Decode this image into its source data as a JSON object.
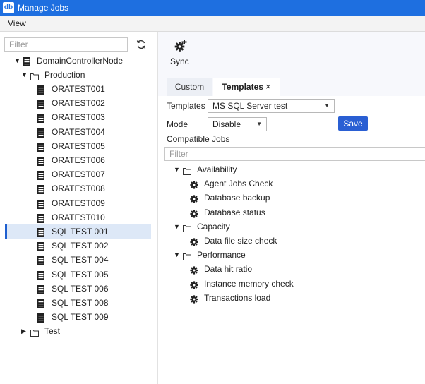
{
  "window": {
    "app_icon": "db",
    "title": "Manage Jobs"
  },
  "menu": {
    "view": "View"
  },
  "left": {
    "filter_placeholder": "Filter",
    "tree": {
      "root": "DomainControllerNode",
      "production": "Production",
      "servers": [
        "ORATEST001",
        "ORATEST002",
        "ORATEST003",
        "ORATEST004",
        "ORATEST005",
        "ORATEST006",
        "ORATEST007",
        "ORATEST008",
        "ORATEST009",
        "ORATEST010",
        "SQL TEST 001",
        "SQL TEST 002",
        "SQL TEST 004",
        "SQL TEST 005",
        "SQL TEST 006",
        "SQL TEST 008",
        "SQL TEST 009"
      ],
      "selected": "SQL TEST 001",
      "test": "Test"
    }
  },
  "toolbar": {
    "sync_label": "Sync"
  },
  "tabs": {
    "custom": "Custom",
    "templates": "Templates",
    "close": "×"
  },
  "form": {
    "templates_label": "Templates",
    "templates_value": "MS SQL Server test",
    "mode_label": "Mode",
    "mode_value": "Disable",
    "save_label": "Save",
    "compatible_jobs_label": "Compatible Jobs",
    "filter_placeholder": "Filter"
  },
  "jobs": {
    "groups": [
      {
        "name": "Availability",
        "items": [
          "Agent Jobs Check",
          "Database backup",
          "Database status"
        ]
      },
      {
        "name": "Capacity",
        "items": [
          "Data file size check"
        ]
      },
      {
        "name": "Performance",
        "items": [
          "Data hit ratio",
          "Instance memory check",
          "Transactions load"
        ]
      }
    ]
  },
  "colors": {
    "titlebar": "#1e6fe0",
    "accent": "#2a5fd3",
    "selection": "#dde8f7"
  },
  "icons": {
    "refresh": "refresh-icon",
    "sync": "sync-gear-icon",
    "server": "server-icon",
    "folder": "folder-icon",
    "job": "gear-icon"
  }
}
